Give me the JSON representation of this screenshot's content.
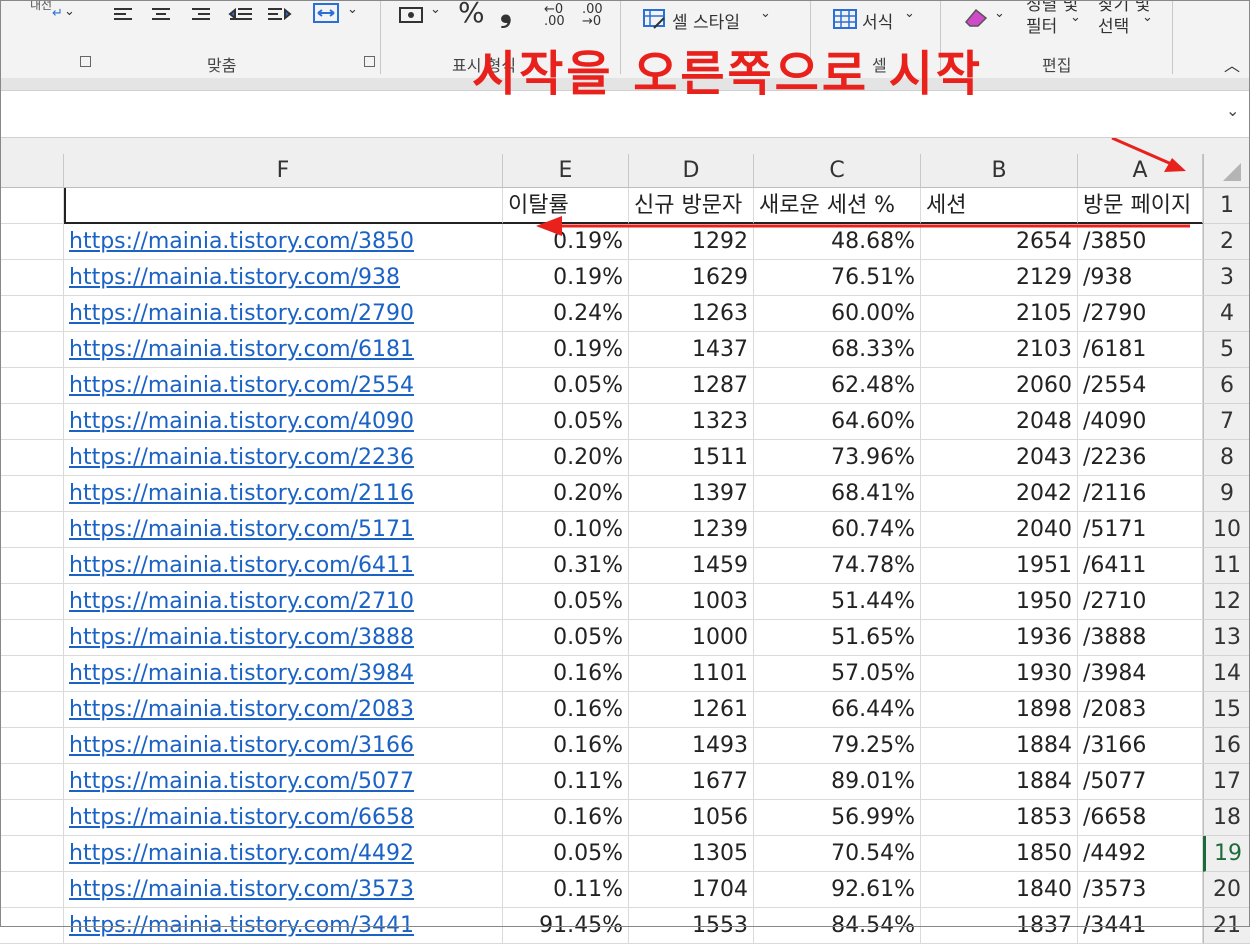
{
  "ribbon": {
    "wrap_label": "내선",
    "percent_symbol": "%",
    "comma_symbol": "❟",
    "inc_decimal": ".00",
    "dec_decimal": ".00",
    "cell_style": "셀 스타일",
    "format": "서식",
    "sort_filter_top": "정렬 및",
    "sort_filter": "필터",
    "find_select_top": "찾기 및",
    "find_select": "선택",
    "group_alignment": "맞춤",
    "group_number": "표시 형식",
    "group_cells": "셀",
    "group_editing": "편집"
  },
  "annotation": {
    "text": "시작을 오른쪽으로 시작",
    "color": "#e8211c"
  },
  "sheet": {
    "column_letters": [
      "F",
      "E",
      "D",
      "C",
      "B",
      "A"
    ],
    "header_row": {
      "row_number": "1",
      "F": "",
      "E": "이탈률",
      "D": "신규 방문자",
      "C": "새로운 세션 %",
      "B": "세션",
      "A": "방문 페이지"
    },
    "rows": [
      {
        "n": "2",
        "F": "https://mainia.tistory.com/3850",
        "E": "0.19%",
        "D": "1292",
        "C": "48.68%",
        "B": "2654",
        "A": "/3850"
      },
      {
        "n": "3",
        "F": "https://mainia.tistory.com/938",
        "E": "0.19%",
        "D": "1629",
        "C": "76.51%",
        "B": "2129",
        "A": "/938"
      },
      {
        "n": "4",
        "F": "https://mainia.tistory.com/2790",
        "E": "0.24%",
        "D": "1263",
        "C": "60.00%",
        "B": "2105",
        "A": "/2790"
      },
      {
        "n": "5",
        "F": "https://mainia.tistory.com/6181",
        "E": "0.19%",
        "D": "1437",
        "C": "68.33%",
        "B": "2103",
        "A": "/6181"
      },
      {
        "n": "6",
        "F": "https://mainia.tistory.com/2554",
        "E": "0.05%",
        "D": "1287",
        "C": "62.48%",
        "B": "2060",
        "A": "/2554"
      },
      {
        "n": "7",
        "F": "https://mainia.tistory.com/4090",
        "E": "0.05%",
        "D": "1323",
        "C": "64.60%",
        "B": "2048",
        "A": "/4090"
      },
      {
        "n": "8",
        "F": "https://mainia.tistory.com/2236",
        "E": "0.20%",
        "D": "1511",
        "C": "73.96%",
        "B": "2043",
        "A": "/2236"
      },
      {
        "n": "9",
        "F": "https://mainia.tistory.com/2116",
        "E": "0.20%",
        "D": "1397",
        "C": "68.41%",
        "B": "2042",
        "A": "/2116"
      },
      {
        "n": "10",
        "F": "https://mainia.tistory.com/5171",
        "E": "0.10%",
        "D": "1239",
        "C": "60.74%",
        "B": "2040",
        "A": "/5171"
      },
      {
        "n": "11",
        "F": "https://mainia.tistory.com/6411",
        "E": "0.31%",
        "D": "1459",
        "C": "74.78%",
        "B": "1951",
        "A": "/6411"
      },
      {
        "n": "12",
        "F": "https://mainia.tistory.com/2710",
        "E": "0.05%",
        "D": "1003",
        "C": "51.44%",
        "B": "1950",
        "A": "/2710"
      },
      {
        "n": "13",
        "F": "https://mainia.tistory.com/3888",
        "E": "0.05%",
        "D": "1000",
        "C": "51.65%",
        "B": "1936",
        "A": "/3888"
      },
      {
        "n": "14",
        "F": "https://mainia.tistory.com/3984",
        "E": "0.16%",
        "D": "1101",
        "C": "57.05%",
        "B": "1930",
        "A": "/3984"
      },
      {
        "n": "15",
        "F": "https://mainia.tistory.com/2083",
        "E": "0.16%",
        "D": "1261",
        "C": "66.44%",
        "B": "1898",
        "A": "/2083"
      },
      {
        "n": "16",
        "F": "https://mainia.tistory.com/3166",
        "E": "0.16%",
        "D": "1493",
        "C": "79.25%",
        "B": "1884",
        "A": "/3166"
      },
      {
        "n": "17",
        "F": "https://mainia.tistory.com/5077",
        "E": "0.11%",
        "D": "1677",
        "C": "89.01%",
        "B": "1884",
        "A": "/5077"
      },
      {
        "n": "18",
        "F": "https://mainia.tistory.com/6658",
        "E": "0.16%",
        "D": "1056",
        "C": "56.99%",
        "B": "1853",
        "A": "/6658"
      },
      {
        "n": "19",
        "F": "https://mainia.tistory.com/4492",
        "E": "0.05%",
        "D": "1305",
        "C": "70.54%",
        "B": "1850",
        "A": "/4492"
      },
      {
        "n": "20",
        "F": "https://mainia.tistory.com/3573",
        "E": "0.11%",
        "D": "1704",
        "C": "92.61%",
        "B": "1840",
        "A": "/3573"
      },
      {
        "n": "21",
        "F": "https://mainia.tistory.com/3441",
        "E": "91.45%",
        "D": "1553",
        "C": "84.54%",
        "B": "1837",
        "A": "/3441"
      }
    ],
    "selected_row": "19"
  }
}
